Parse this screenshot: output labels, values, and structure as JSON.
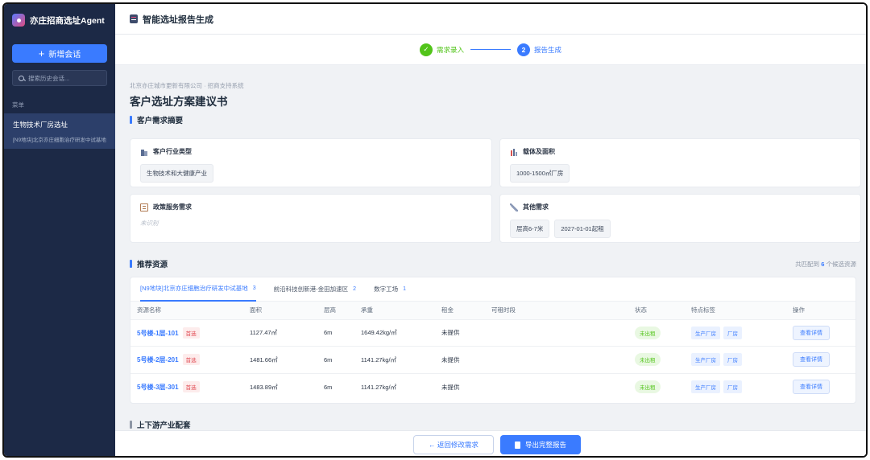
{
  "sidebar": {
    "brand": "亦庄招商选址Agent",
    "new_chat_label": "新增会话",
    "search_placeholder": "搜索历史会话...",
    "section_label": "菜单",
    "history": [
      {
        "title": "生物技术厂房选址",
        "subtitle": "[N9地块]北京亦庄细胞治疗研发中试基地"
      }
    ]
  },
  "header": {
    "title": "智能选址报告生成"
  },
  "steps": [
    {
      "num": "✓",
      "label": "需求录入"
    },
    {
      "num": "2",
      "label": "报告生成"
    }
  ],
  "report": {
    "crumb": "北京亦庄城市更新有限公司 · 招商支持系统",
    "title": "客户选址方案建议书",
    "summary_heading": "客户需求摘要",
    "cards": {
      "industry": {
        "label": "客户行业类型",
        "chips": [
          "生物技术和大健康产业"
        ]
      },
      "area": {
        "label": "载体及面积",
        "chips": [
          "1000-1500㎡厂房"
        ]
      },
      "policy": {
        "label": "政策服务需求",
        "empty": "未识别"
      },
      "other": {
        "label": "其他需求",
        "chips": [
          "层高6-7米",
          "2027-01-01起租"
        ]
      }
    },
    "recommend_heading": "推荐资源",
    "match_prefix": "共匹配到",
    "match_count": "6",
    "match_suffix": "个候选资源",
    "tabs": [
      {
        "label": "[N9地块]北京亦庄细胞治疗研发中试基地",
        "count": "3"
      },
      {
        "label": "前沿科技创新港-金田加速区",
        "count": "2"
      },
      {
        "label": "数字工场",
        "count": "1"
      }
    ],
    "columns": [
      "资源名称",
      "面积",
      "层高",
      "承重",
      "租金",
      "可租时段",
      "状态",
      "特点标签",
      "操作"
    ],
    "first_tag": "首选",
    "view_label": "查看详情",
    "rows": [
      {
        "name": "5号楼-1层-101",
        "area": "1127.47㎡",
        "height": "6m",
        "load": "1649.42kg/㎡",
        "rent": "未提供",
        "period": "",
        "status": "未出租",
        "tags": [
          "生产厂房",
          "厂房"
        ]
      },
      {
        "name": "5号楼-2层-201",
        "area": "1481.66㎡",
        "height": "6m",
        "load": "1141.27kg/㎡",
        "rent": "未提供",
        "period": "",
        "status": "未出租",
        "tags": [
          "生产厂房",
          "厂房"
        ]
      },
      {
        "name": "5号楼-3层-301",
        "area": "1483.89㎡",
        "height": "6m",
        "load": "1141.27kg/㎡",
        "rent": "未提供",
        "period": "",
        "status": "未出租",
        "tags": [
          "生产厂房",
          "厂房"
        ]
      }
    ],
    "chain_heading": "上下游产业配套"
  },
  "footer": {
    "back_label": "← 返回修改需求",
    "export_label": "导出完整报告"
  }
}
